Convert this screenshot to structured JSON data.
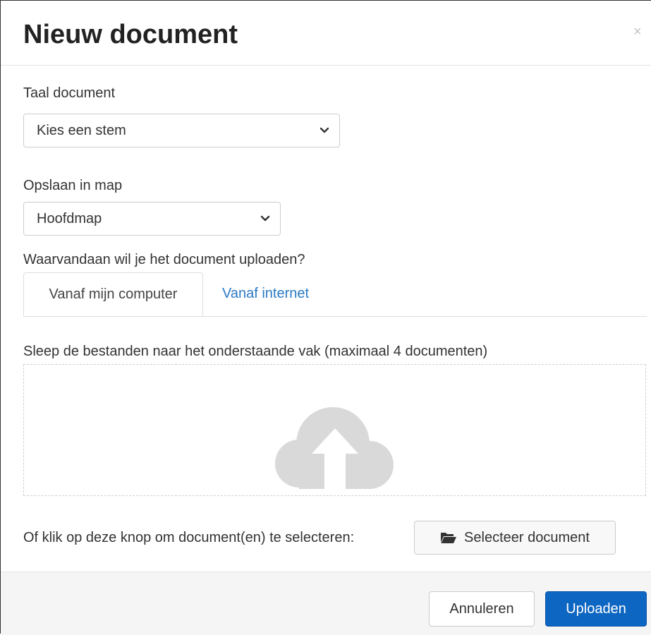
{
  "modal": {
    "title": "Nieuw document",
    "close_symbol": "×"
  },
  "language": {
    "label": "Taal document",
    "selected": "Kies een stem"
  },
  "folder": {
    "label": "Opslaan in map",
    "selected": "Hoofdmap"
  },
  "source": {
    "question": "Waarvandaan wil je het document uploaden?",
    "tabs": [
      {
        "label": "Vanaf mijn computer",
        "active": true
      },
      {
        "label": "Vanaf internet",
        "active": false
      }
    ]
  },
  "dropzone": {
    "instruction": "Sleep de bestanden naar het onderstaande vak (maximaal 4 documenten)",
    "icon": "cloud-upload-icon"
  },
  "select": {
    "prompt": "Of klik op deze knop om document(en) te selecteren:",
    "button_label": "Selecteer document",
    "button_icon": "folder-open-icon"
  },
  "footer": {
    "cancel_label": "Annuleren",
    "upload_label": "Uploaden"
  },
  "colors": {
    "primary": "#0d66c2",
    "link": "#2a7ac4",
    "icon_gray": "#d9d9d9"
  }
}
